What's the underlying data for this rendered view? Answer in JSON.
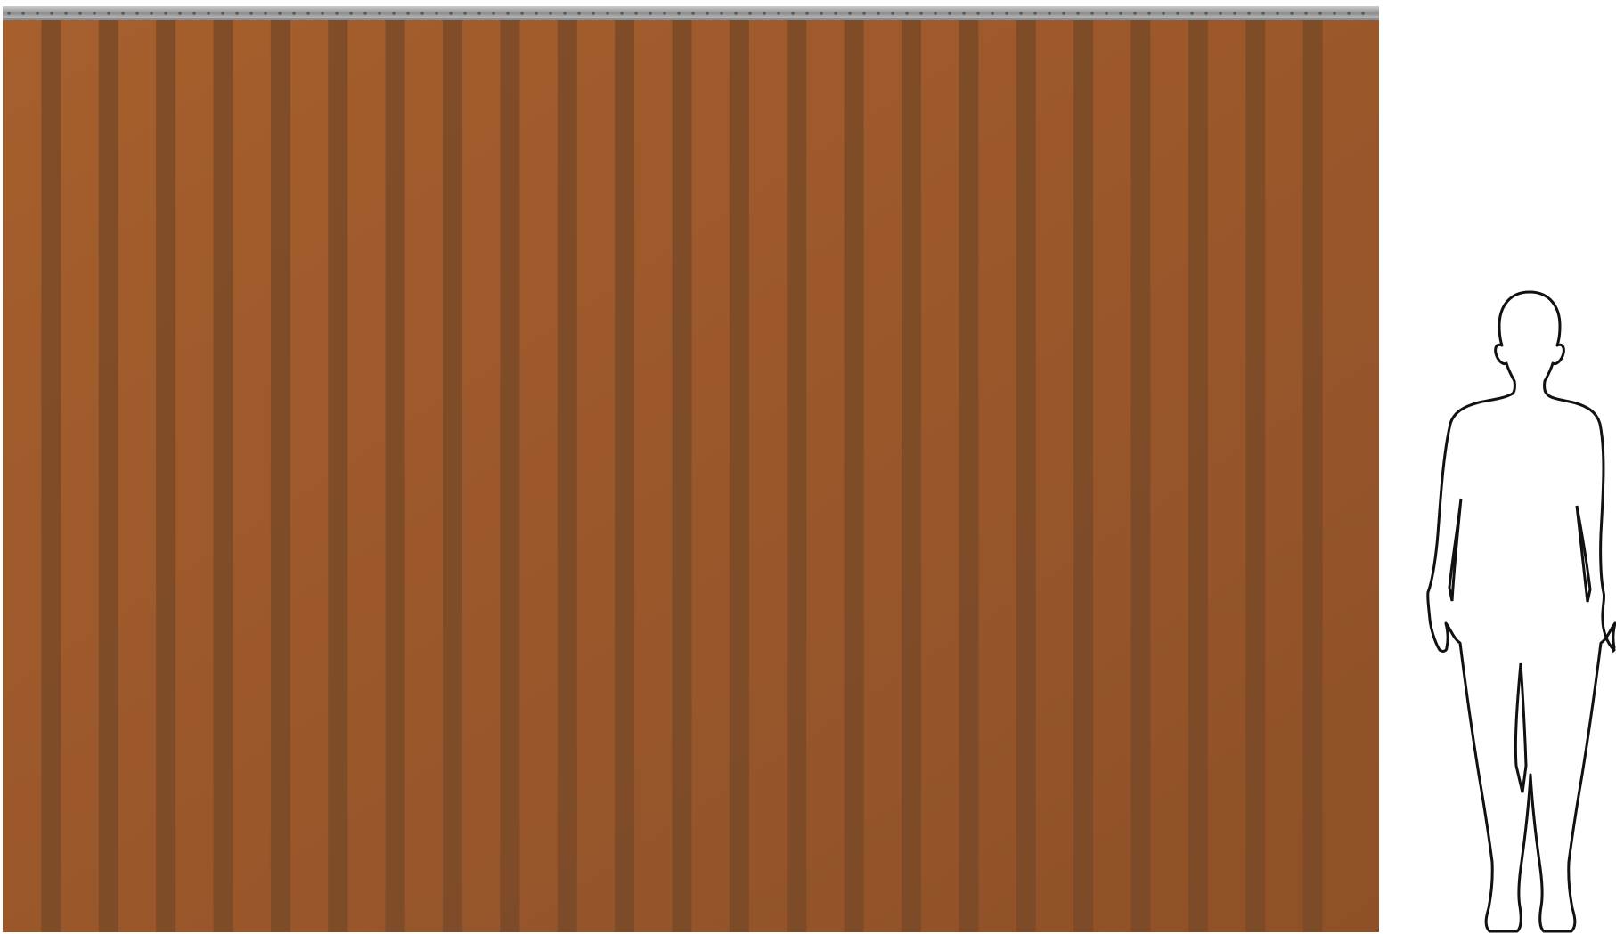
{
  "scene": {
    "subject": "strip-curtain",
    "strip_count": 24,
    "colors": {
      "background": "#ffffff",
      "curtain_light": "#a65f2d",
      "curtain_dark": "#8f5028",
      "overlap": "#7a4a28",
      "rail_light": "#cfcfcf",
      "rail_dark": "#8d8d8d",
      "rivet": "#5a5a5a",
      "figure_fill": "#ffffff",
      "figure_stroke": "#111111"
    },
    "icons": {
      "rail": "mounting-rail-icon",
      "figure": "person-silhouette-icon"
    }
  }
}
